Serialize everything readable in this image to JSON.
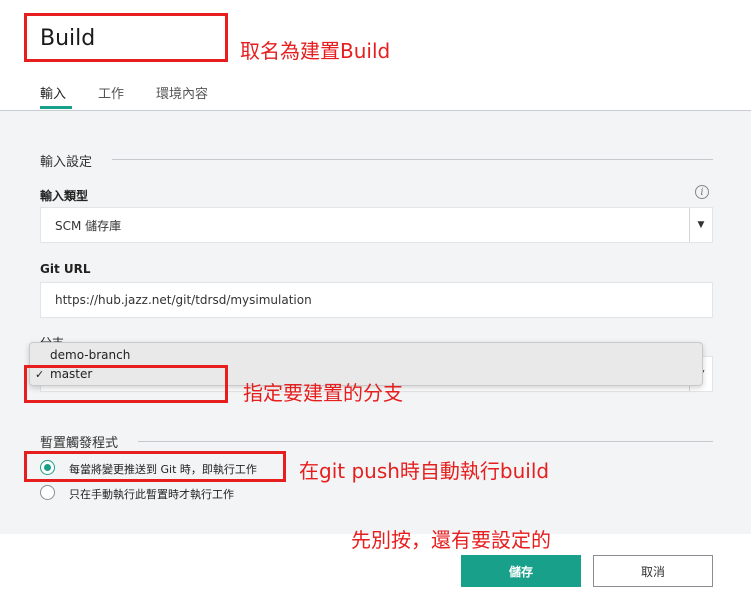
{
  "header": {
    "title": "Build",
    "tabs": [
      {
        "label": "輸入"
      },
      {
        "label": "工作"
      },
      {
        "label": "環境內容"
      }
    ]
  },
  "input_settings": {
    "section_title": "輸入設定",
    "input_type": {
      "label": "輸入類型",
      "value": "SCM 儲存庫"
    },
    "git_url": {
      "label": "Git URL",
      "value": "https://hub.jazz.net/git/tdrsd/mysimulation"
    },
    "branch": {
      "label": "分支",
      "options": [
        "demo-branch",
        "master"
      ],
      "selected": "master",
      "checkmark": "✓"
    }
  },
  "trigger": {
    "section_title": "暫置觸發程式",
    "options": [
      {
        "label": "每當將變更推送到 Git 時，即執行工作",
        "selected": true
      },
      {
        "label": "只在手動執行此暫置時才執行工作",
        "selected": false
      }
    ]
  },
  "footer": {
    "save_label": "儲存",
    "cancel_label": "取消"
  },
  "annotations": {
    "name_note": "取名為建置Build",
    "branch_note": "指定要建置的分支",
    "trigger_note": "在git push時自動執行build",
    "save_note": "先別按，還有要設定的"
  },
  "colors": {
    "accent": "#19a08a",
    "annotation": "#e61e1e"
  },
  "icons": {
    "info": "info-icon",
    "dropdown": "caret-down-icon"
  }
}
